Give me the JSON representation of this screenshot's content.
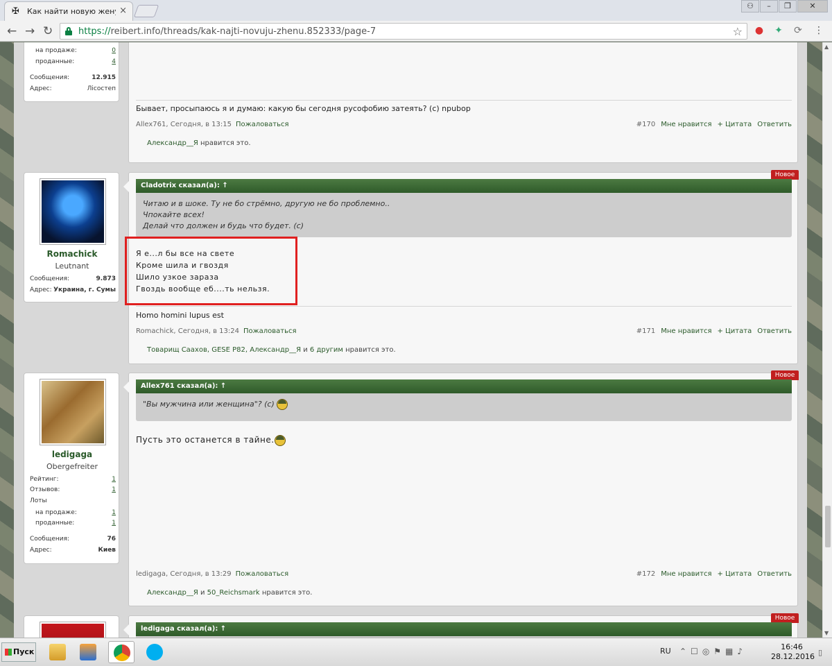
{
  "browser": {
    "tab_title": "Как найти новую жену?",
    "tab_favicon": "iron-cross-icon",
    "url_scheme": "https://",
    "url_rest": "reibert.info/threads/kak-najti-novuju-zhenu.852333/page-7"
  },
  "posts": {
    "p0": {
      "user": {
        "stat_forsale_label": "на продаже:",
        "stat_forsale_val": "0",
        "stat_sold_label": "проданные:",
        "stat_sold_val": "4",
        "stat_msgs_label": "Сообщения:",
        "stat_msgs_val": "12.915",
        "stat_addr_label": "Адрес:",
        "stat_addr_val": "Лісостеп"
      },
      "signature": "Бывает, просыпаюсь я и думаю: какую бы сегодня русофобию затеять? (с) npubop",
      "author": "Allex761",
      "time": ", Сегодня, в 13:15",
      "report": "Пожаловаться",
      "num": "#170",
      "like": "Мне нравится",
      "quote": "+ Цитата",
      "reply": "Ответить",
      "likes_who": "Александр__Я",
      "likes_tail": " нравится это."
    },
    "p1": {
      "badge": "Новое",
      "user": {
        "name": "Romachick",
        "title": "Leutnant",
        "stat_msgs_label": "Сообщения:",
        "stat_msgs_val": "9.873",
        "stat_addr_label": "Адрес:",
        "stat_addr_val": "Украина, г. Сумы"
      },
      "quote_head": "Cladotrix сказал(а): ↑",
      "quote_line1": "Читаю и в шоке. Ту не бо стрёмно, другую не бо проблемно..",
      "quote_line2": "Чпокайте всех!",
      "quote_line3": "Делай что должен и будь что будет. (с)",
      "line1": "Я е...л бы все на свете",
      "line2": "Кроме шила и гвоздя",
      "line3": "Шило узкое зараза",
      "line4": "Гвоздь вообще еб....ть нельзя.",
      "signature": "Homo homini lupus est",
      "author": "Romachick",
      "time": ", Сегодня, в 13:24",
      "report": "Пожаловаться",
      "num": "#171",
      "like": "Мне нравится",
      "quote": "+ Цитата",
      "reply": "Ответить",
      "likes_who": "Товарищ Саахов, GESE P82, Александр__Я",
      "likes_mid": " и ",
      "likes_who2": "6 другим",
      "likes_tail": " нравится это."
    },
    "p2": {
      "badge": "Новое",
      "user": {
        "name": "ledigaga",
        "title": "Obergefreiter",
        "stat_rating_label": "Рейтинг:",
        "stat_rating_val": "1",
        "stat_reviews_label": "Отзывов:",
        "stat_reviews_val": "1",
        "stat_lots_label": "Лоты",
        "stat_forsale_label": "на продаже:",
        "stat_forsale_val": "1",
        "stat_sold_label": "проданные:",
        "stat_sold_val": "1",
        "stat_msgs_label": "Сообщения:",
        "stat_msgs_val": "76",
        "stat_addr_label": "Адрес:",
        "stat_addr_val": "Киев"
      },
      "quote_head": "Allex761 сказал(а): ↑",
      "quote_text": "\"Вы мужчина или женщина\"? (с)",
      "body": "Пусть это останется в тайне.",
      "author": "ledigaga",
      "time": ", Сегодня, в 13:29",
      "report": "Пожаловаться",
      "num": "#172",
      "like": "Мне нравится",
      "quote": "+ Цитата",
      "reply": "Ответить",
      "likes_who": "Александр__Я",
      "likes_mid": " и ",
      "likes_who2": "50_Reichsmark",
      "likes_tail": " нравится это."
    },
    "p3": {
      "badge": "Новое",
      "quote_head": "ledigaga сказал(а): ↑"
    }
  },
  "taskbar": {
    "start": "Пуск",
    "lang": "RU",
    "time": "16:46",
    "date": "28.12.2016"
  }
}
